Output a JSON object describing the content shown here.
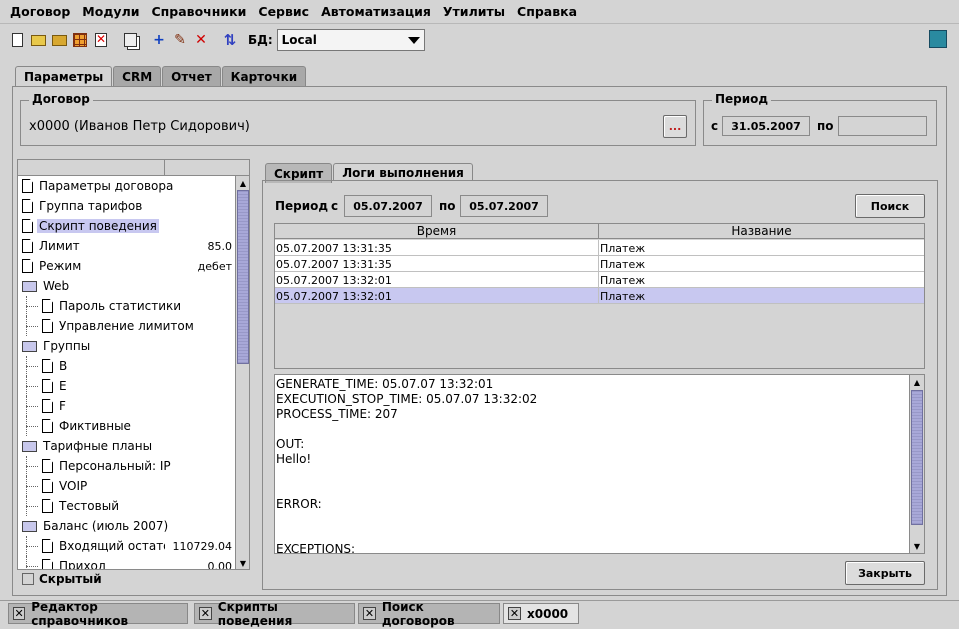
{
  "menu": [
    "Договор",
    "Модули",
    "Справочники",
    "Сервис",
    "Автоматизация",
    "Утилиты",
    "Справка"
  ],
  "toolbar": {
    "icons": [
      "new-document-icon",
      "open-folder-icon",
      "folder-icon",
      "table-icon",
      "delete-icon",
      "copy-icon",
      "add-icon",
      "edit-icon",
      "remove-icon",
      "refresh-icon"
    ],
    "db_label": "БД:",
    "db_value": "Local",
    "exit_icon": "exit-icon"
  },
  "main_tabs": [
    "Параметры",
    "CRM",
    "Отчет",
    "Карточки"
  ],
  "contract": {
    "title": "Договор",
    "value": "x0000 (Иванов Петр Сидорович)",
    "browse_label": "..."
  },
  "period": {
    "title": "Период",
    "from_label": "с",
    "from_value": "31.05.2007",
    "to_label": "по",
    "to_value": ""
  },
  "tree": {
    "items": [
      {
        "label": "Параметры договора",
        "value": "",
        "icon": "leaf",
        "level": 0,
        "selected": false
      },
      {
        "label": "Группа тарифов",
        "value": "",
        "icon": "leaf",
        "level": 0,
        "selected": false
      },
      {
        "label": "Скрипт поведения",
        "value": "",
        "icon": "leaf",
        "level": 0,
        "selected": true
      },
      {
        "label": "Лимит",
        "value": "85.0",
        "icon": "leaf",
        "level": 0,
        "selected": false
      },
      {
        "label": "Режим",
        "value": "дебет",
        "icon": "leaf",
        "level": 0,
        "selected": false
      },
      {
        "label": "Web",
        "value": "",
        "icon": "folder",
        "level": 0,
        "selected": false
      },
      {
        "label": "Пароль статистики",
        "value": "",
        "icon": "leaf",
        "level": 1,
        "selected": false
      },
      {
        "label": "Управление лимитом",
        "value": "",
        "icon": "leaf",
        "level": 1,
        "selected": false
      },
      {
        "label": "Группы",
        "value": "",
        "icon": "folder",
        "level": 0,
        "selected": false
      },
      {
        "label": "B",
        "value": "",
        "icon": "leaf",
        "level": 1,
        "selected": false
      },
      {
        "label": "E",
        "value": "",
        "icon": "leaf",
        "level": 1,
        "selected": false
      },
      {
        "label": "F",
        "value": "",
        "icon": "leaf",
        "level": 1,
        "selected": false
      },
      {
        "label": "Фиктивные",
        "value": "",
        "icon": "leaf",
        "level": 1,
        "selected": false
      },
      {
        "label": "Тарифные планы",
        "value": "",
        "icon": "folder",
        "level": 0,
        "selected": false
      },
      {
        "label": "Персональный: IP",
        "value": "",
        "icon": "leaf",
        "level": 1,
        "selected": false
      },
      {
        "label": "VOIP",
        "value": "",
        "icon": "leaf",
        "level": 1,
        "selected": false
      },
      {
        "label": "Тестовый",
        "value": "",
        "icon": "leaf",
        "level": 1,
        "selected": false
      },
      {
        "label": "Баланс (июль 2007)",
        "value": "",
        "icon": "folder",
        "level": 0,
        "selected": false
      },
      {
        "label": "Входящий остаток",
        "value": "110729.04",
        "icon": "leaf",
        "level": 1,
        "selected": false
      },
      {
        "label": "Приход",
        "value": "0.00",
        "icon": "leaf",
        "level": 1,
        "selected": false
      }
    ]
  },
  "hidden_checkbox_label": "Скрытый",
  "sub_tabs": [
    "Скрипт",
    "Логи выполнения"
  ],
  "search": {
    "period_label": "Период",
    "from_label": "с",
    "from_value": "05.07.2007",
    "to_label": "по",
    "to_value": "05.07.2007",
    "button_label": "Поиск"
  },
  "log_table": {
    "columns": [
      "Время",
      "Название"
    ],
    "rows": [
      {
        "time": "05.07.2007 13:31:35",
        "name": "Платеж",
        "selected": false
      },
      {
        "time": "05.07.2007 13:31:35",
        "name": "Платеж",
        "selected": false
      },
      {
        "time": "05.07.2007 13:32:01",
        "name": "Платеж",
        "selected": false
      },
      {
        "time": "05.07.2007 13:32:01",
        "name": "Платеж",
        "selected": true
      }
    ]
  },
  "log_output": "GENERATE_TIME: 05.07.07 13:32:01\nEXECUTION_STOP_TIME: 05.07.07 13:32:02\nPROCESS_TIME: 207\n\nOUT:\nHello!\n\n\nERROR:\n\n\nEXCEPTIONS:",
  "close_button": "Закрыть",
  "taskbar": [
    {
      "label": "Редактор справочников",
      "active": false
    },
    {
      "label": "Скрипты поведения",
      "active": false
    },
    {
      "label": "Поиск договоров",
      "active": false
    },
    {
      "label": "x0000",
      "active": true
    }
  ]
}
